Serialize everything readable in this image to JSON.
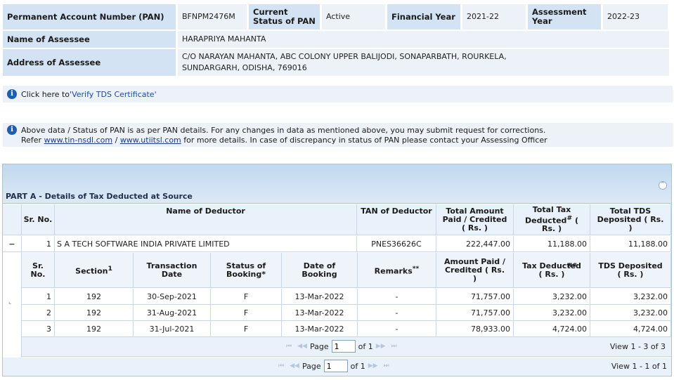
{
  "header": {
    "pan_label": "Permanent Account Number (PAN)",
    "pan_value": "BFNPM2476M",
    "status_label": "Current Status of PAN",
    "status_value": "Active",
    "fy_label": "Financial Year",
    "fy_value": "2021-22",
    "ay_label": "Assessment Year",
    "ay_value": "2022-23",
    "name_label": "Name of Assessee",
    "name_value": "HARAPRIYA MAHANTA",
    "address_label": "Address of Assessee",
    "address_line1": "C/O NARAYAN MAHANTA, ABC COLONY UPPER BALIJODI, SONAPARBATH, ROURKELA,",
    "address_line2": "SUNDARGARH, ODISHA, 769016"
  },
  "verify_notice": {
    "prefix": "Click here to ",
    "link": "'Verify TDS Certificate'"
  },
  "pan_notice": {
    "line1": "Above data / Status of PAN is as per PAN details. For any changes in data as mentioned above, you may submit request for corrections.",
    "refer": "Refer ",
    "link1": "www.tin-nsdl.com",
    "sep": " / ",
    "link2": "www.utiitsl.com",
    "rest": " for more details. In case of discrepancy in status of PAN please contact your Assessing Officer"
  },
  "grid": {
    "title": "PART A - Details of Tax Deducted at Source",
    "columns": {
      "sr": "Sr. No.",
      "name": "Name of Deductor",
      "tan": "TAN of Deductor",
      "amount": "Total Amount Paid / Credited ( Rs. )",
      "tax": "Total Tax Deducted",
      "tax_sup": "#",
      "tax_unit": " ( Rs. )",
      "tds": "Total TDS Deposited ( Rs. )"
    },
    "row": {
      "expand": "−",
      "sr": "1",
      "name": "S A TECH SOFTWARE INDIA PRIVATE LIMITED",
      "tan": "PNES36626C",
      "amount": "222,447.00",
      "tax": "11,188.00",
      "tds": "11,188.00"
    },
    "subgrid": {
      "columns": {
        "sr": "Sr. No.",
        "section": "Section",
        "section_sup": "1",
        "txn_date": "Transaction Date",
        "status": "Status of Booking*",
        "booking_date": "Date of Booking",
        "remarks": "Remarks",
        "remarks_sup": "**",
        "amount": "Amount Paid / Credited ( Rs. )",
        "tax": "Tax Deducted",
        "tax_sup": "##",
        "tax_unit": "( Rs. )",
        "tds": "TDS Deposited ( Rs. )"
      },
      "rows": [
        {
          "sr": "1",
          "section": "192",
          "txn_date": "30-Sep-2021",
          "status": "F",
          "booking_date": "13-Mar-2022",
          "remarks": "-",
          "amount": "71,757.00",
          "tax": "3,232.00",
          "tds": "3,232.00"
        },
        {
          "sr": "2",
          "section": "192",
          "txn_date": "31-Aug-2021",
          "status": "F",
          "booking_date": "13-Mar-2022",
          "remarks": "-",
          "amount": "71,757.00",
          "tax": "3,232.00",
          "tds": "3,232.00"
        },
        {
          "sr": "3",
          "section": "192",
          "txn_date": "31-Jul-2021",
          "status": "F",
          "booking_date": "13-Mar-2022",
          "remarks": "-",
          "amount": "78,933.00",
          "tax": "4,724.00",
          "tds": "4,724.00"
        }
      ],
      "pager": {
        "page_label": "Page",
        "page_value": "1",
        "of_label": "of 1",
        "view": "View 1 - 3 of 3"
      }
    },
    "pager": {
      "page_label": "Page",
      "page_value": "1",
      "of_label": "of 1",
      "view": "View 1 - 1 of 1"
    }
  }
}
